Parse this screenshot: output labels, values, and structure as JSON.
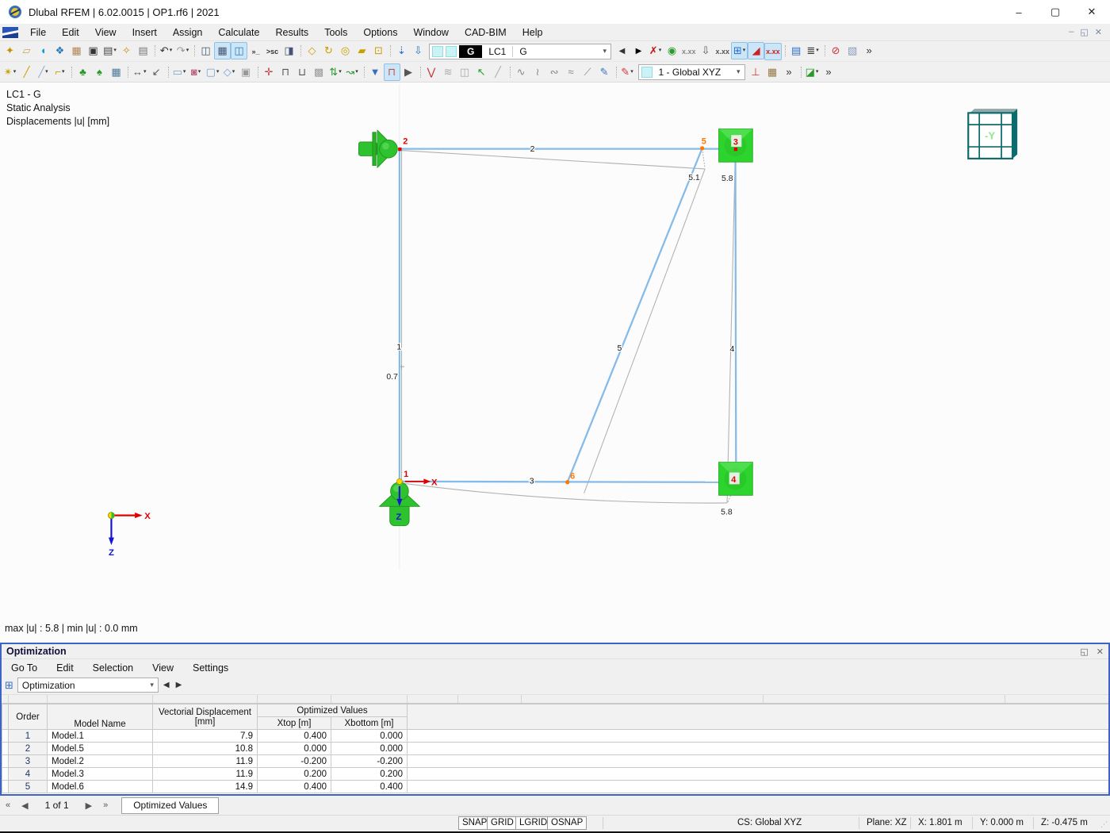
{
  "chrome": {
    "dropdown_glyph": "▾",
    "minimize": "–",
    "maximize": "▢",
    "close": "✕",
    "mdi_minimize": "–",
    "mdi_restore": "◱",
    "mdi_close": "✕",
    "float_glyph": "◱",
    "overflow": "»"
  },
  "window": {
    "title": "Dlubal RFEM | 6.02.0015 | OP1.rf6 | 2021"
  },
  "menu": {
    "items": [
      "File",
      "Edit",
      "View",
      "Insert",
      "Assign",
      "Calculate",
      "Results",
      "Tools",
      "Options",
      "Window",
      "CAD-BIM",
      "Help"
    ]
  },
  "toolbar1": {
    "icons_a": [
      {
        "n": "new-model-icon",
        "g": "✦",
        "c": "#c89000"
      },
      {
        "n": "open-model-icon",
        "g": "▱",
        "c": "#c8a850"
      },
      {
        "n": "dlubal-center-icon",
        "g": "◖",
        "c": "#0a9bd7"
      },
      {
        "n": "model-manager-icon",
        "g": "❖",
        "c": "#2a7ab8"
      },
      {
        "n": "save-image-icon",
        "g": "▦",
        "c": "#b08858"
      },
      {
        "n": "save-icon",
        "g": "▣",
        "c": "#333333"
      },
      {
        "n": "print-icon",
        "g": "▤",
        "c": "#444444",
        "d": 1
      },
      {
        "n": "new-printout-report-icon",
        "g": "✧",
        "c": "#c89000"
      },
      {
        "n": "printout-report-icon",
        "g": "▤",
        "c": "#777777"
      },
      {
        "sep": 1
      },
      {
        "n": "undo-icon",
        "g": "↶",
        "c": "#333333",
        "d": 1
      },
      {
        "n": "redo-icon",
        "g": "↷",
        "c": "#9a9a9a",
        "d": 1
      },
      {
        "sep": 1
      },
      {
        "n": "navigator-icon",
        "g": "◫",
        "c": "#445577"
      },
      {
        "n": "tables-icon",
        "g": "▦",
        "c": "#445577",
        "a": 1
      },
      {
        "n": "active-table-icon",
        "g": "◫",
        "c": "#2a7ab8",
        "a": 1
      },
      {
        "n": "console-icon",
        "g": "»_",
        "c": "#333333",
        "t": 1
      },
      {
        "n": "script-icon",
        "g": ">sc",
        "c": "#333333",
        "t": 1
      },
      {
        "n": "table-manager-icon",
        "g": "◨",
        "c": "#445577"
      },
      {
        "sep": 1
      },
      {
        "n": "select-line-icon",
        "g": "◇",
        "c": "#c8a000"
      },
      {
        "n": "select-rotate-icon",
        "g": "↻",
        "c": "#c8a000"
      },
      {
        "n": "select-circle-icon",
        "g": "◎",
        "c": "#c8a000"
      },
      {
        "n": "select-region-icon",
        "g": "▰",
        "c": "#c8a000"
      },
      {
        "n": "select-numbering-icon",
        "g": "⊡",
        "c": "#c8a000"
      },
      {
        "sep": 1
      },
      {
        "n": "new-load-icon",
        "g": "⇣",
        "c": "#2a6fd0"
      },
      {
        "n": "apply-load-icon",
        "g": "⇩",
        "c": "#2a6fd0"
      }
    ],
    "load_case": {
      "tag": "G",
      "name": "LC1",
      "desc": "G"
    },
    "combo_prev": "◀",
    "combo_next": "▶",
    "icons_b": [
      {
        "n": "filter-results-icon",
        "g": "✗",
        "c": "#cc1111",
        "d": 1
      },
      {
        "n": "show-results-icon",
        "g": "◉",
        "c": "#2a9a2a"
      },
      {
        "n": "show-result-values-icon",
        "g": "x.xx",
        "c": "#888888",
        "t": 1
      },
      {
        "n": "show-loads-icon",
        "g": "⇩",
        "c": "#555555"
      },
      {
        "n": "show-load-values-icon",
        "g": "x.xx",
        "c": "#555555",
        "t": 1
      },
      {
        "n": "results-grid-icon",
        "g": "⊞",
        "c": "#2a6fd0",
        "d": 1,
        "a": 1
      },
      {
        "n": "result-diagram-icon",
        "g": "◢",
        "c": "#cc2222",
        "a": 1
      },
      {
        "n": "result-values-icon",
        "g": "x.xx",
        "c": "#cc2222",
        "t": 1,
        "a": 1
      },
      {
        "sep": 1
      },
      {
        "n": "print-graphic-icon",
        "g": "▤",
        "c": "#2a6fd0"
      },
      {
        "n": "calculation-icon",
        "g": "≣",
        "c": "#333333",
        "d": 1
      },
      {
        "sep": 1
      },
      {
        "n": "zoom-reset-icon",
        "g": "⊘",
        "c": "#cc3333"
      },
      {
        "n": "solid-view-icon",
        "g": "▧",
        "c": "#8899bb"
      },
      {
        "n": "toolbar1-overflow-icon",
        "g": "»",
        "c": "#333333"
      }
    ]
  },
  "toolbar2": {
    "icons_a": [
      {
        "n": "new-node-icon",
        "g": "✴",
        "c": "#c8a000",
        "d": 1
      },
      {
        "n": "new-line-icon",
        "g": "╱",
        "c": "#c8a000"
      },
      {
        "n": "new-member-icon",
        "g": "╱",
        "c": "#88aadd",
        "d": 1
      },
      {
        "n": "new-polyline-icon",
        "g": "⌐",
        "c": "#c8a000",
        "d": 1
      },
      {
        "sep": 1
      },
      {
        "n": "new-tree-icon",
        "g": "♣",
        "c": "#2a9a2a"
      },
      {
        "n": "new-vegetation-icon",
        "g": "♠",
        "c": "#2a9a2a"
      },
      {
        "n": "new-building-icon",
        "g": "▦",
        "c": "#4a7a9a"
      },
      {
        "sep": 1
      },
      {
        "n": "dimension-icon",
        "g": "↔",
        "c": "#555555",
        "d": 1
      },
      {
        "n": "dimension-edit-icon",
        "g": "↙",
        "c": "#555555"
      },
      {
        "sep": 1
      },
      {
        "n": "new-surface-icon",
        "g": "▭",
        "c": "#7aa0d0",
        "d": 1
      },
      {
        "n": "load-wizard-icon",
        "g": "◙",
        "c": "#c06080",
        "d": 1
      },
      {
        "n": "new-opening-icon",
        "g": "▢",
        "c": "#7aa0d0",
        "d": 1
      },
      {
        "n": "new-solid-icon",
        "g": "◇",
        "c": "#7aa0d0",
        "d": 1
      },
      {
        "n": "copy-icon",
        "g": "▣",
        "c": "#999999"
      },
      {
        "sep": 1
      },
      {
        "n": "new-nodal-support-icon",
        "g": "✛",
        "c": "#c04040"
      },
      {
        "n": "new-member-hinge-icon",
        "g": "⊓",
        "c": "#555555"
      },
      {
        "n": "new-line-support-icon",
        "g": "⊔",
        "c": "#555555"
      },
      {
        "n": "new-solid-cage-icon",
        "g": "▩",
        "c": "#999999"
      },
      {
        "n": "imposed-deformation-icon",
        "g": "⇅",
        "c": "#2a9a2a",
        "d": 1
      },
      {
        "n": "new-imperfection-icon",
        "g": "↝",
        "c": "#2a9a2a",
        "d": 1
      },
      {
        "sep": 1
      },
      {
        "n": "filter-icon",
        "g": "▼",
        "c": "#3a6fc0"
      },
      {
        "n": "section-view-icon",
        "g": "⊓",
        "c": "#c05050",
        "a": 1
      },
      {
        "n": "animation-icon",
        "g": "▶",
        "c": "#555555"
      },
      {
        "sep": 1
      },
      {
        "n": "result-beam-icon",
        "g": "⋁",
        "c": "#c03030"
      },
      {
        "n": "surface-result-icon",
        "g": "≋",
        "c": "#aaaaaa"
      },
      {
        "n": "solid-result-icon",
        "g": "◫",
        "c": "#aaaaaa"
      },
      {
        "n": "deformed-structure-icon",
        "g": "↖",
        "c": "#2a9a2a"
      },
      {
        "n": "section-result-icon",
        "g": "╱",
        "c": "#aaaaaa"
      },
      {
        "sep": 1
      },
      {
        "n": "diagram-smooth-icon",
        "g": "∿",
        "c": "#888888"
      },
      {
        "n": "diagram-step-icon",
        "g": "≀",
        "c": "#888888"
      },
      {
        "n": "diagram-dashed-icon",
        "g": "∾",
        "c": "#888888"
      },
      {
        "n": "diagram-double-icon",
        "g": "≈",
        "c": "#888888"
      },
      {
        "n": "diagram-slope-icon",
        "g": "⟋",
        "c": "#888888"
      },
      {
        "n": "diagram-wizard-icon",
        "g": "✎",
        "c": "#3a6fc0"
      },
      {
        "sep": 1
      },
      {
        "n": "color-scale-icon",
        "g": "✎",
        "c": "#cc3333",
        "d": 1
      }
    ],
    "cs_combo": "1 - Global XYZ",
    "icons_b": [
      {
        "n": "coordinate-system-icon",
        "g": "⊥",
        "c": "#cc3333"
      },
      {
        "n": "work-plane-icon",
        "g": "▦",
        "c": "#997744"
      },
      {
        "n": "toolbar2-overflow-a-icon",
        "g": "»",
        "c": "#333333"
      },
      {
        "sep": 1
      },
      {
        "n": "table-settings-icon",
        "g": "◪",
        "c": "#2a9a2a",
        "d": 1
      },
      {
        "n": "toolbar2-overflow-b-icon",
        "g": "»",
        "c": "#333333"
      }
    ]
  },
  "canvas": {
    "info": {
      "line1": "LC1 - G",
      "line2": "Static Analysis",
      "line3": "Displacements |u| [mm]"
    },
    "summary": "max |u| : 5.8 | min |u| : 0.0 mm",
    "labels": {
      "node1": "1",
      "node2": "2",
      "node3": "3",
      "node4": "4",
      "node5": "5",
      "node6": "6",
      "member1": "1",
      "member2": "2",
      "member3": "3",
      "member4": "4",
      "member5": "5",
      "val_top": "5.1",
      "val_right_top": "5.8",
      "val_left": "0.7",
      "val_bottom": "5.8",
      "axis_x": "X",
      "axis_z": "Z",
      "triad_x": "X",
      "triad_z": "Z",
      "view_cube": "-Y"
    },
    "colors": {
      "member": "#85bbe8",
      "deformed": "#b0b0b0",
      "support": "#2ec22e",
      "node_red": "#e00000",
      "node_orange": "#ff7700"
    }
  },
  "panel": {
    "title": "Optimization",
    "menu": [
      "Go To",
      "Edit",
      "Selection",
      "View",
      "Settings"
    ],
    "combo_value": "Optimization",
    "nav_prev": "◀",
    "nav_next": "▶",
    "table": {
      "h_order": "Order",
      "h_model": "Model Name",
      "h_disp1": "Vectorial Displacement",
      "h_disp2": "[mm]",
      "h_opt": "Optimized Values",
      "h_xtop": "Xtop [m]",
      "h_xbottom": "Xbottom [m]",
      "rows": [
        {
          "order": "1",
          "model": "Model.1",
          "disp": "7.9",
          "xtop": "0.400",
          "xbottom": "0.000"
        },
        {
          "order": "2",
          "model": "Model.5",
          "disp": "10.8",
          "xtop": "0.000",
          "xbottom": "0.000"
        },
        {
          "order": "3",
          "model": "Model.2",
          "disp": "11.9",
          "xtop": "-0.200",
          "xbottom": "-0.200"
        },
        {
          "order": "4",
          "model": "Model.3",
          "disp": "11.9",
          "xtop": "0.200",
          "xbottom": "0.200"
        },
        {
          "order": "5",
          "model": "Model.6",
          "disp": "14.9",
          "xtop": "0.400",
          "xbottom": "0.400"
        }
      ]
    }
  },
  "tabbar": {
    "first": "«",
    "prev": "◀",
    "page": "1 of 1",
    "next": "▶",
    "last": "»",
    "tab": "Optimized Values"
  },
  "statusbar": {
    "toggles": [
      "SNAP",
      "GRID",
      "LGRID",
      "OSNAP"
    ],
    "cs": "CS: Global XYZ",
    "plane": "Plane: XZ",
    "x": "X: 1.801 m",
    "y": "Y: 0.000 m",
    "z": "Z: -0.475 m"
  }
}
